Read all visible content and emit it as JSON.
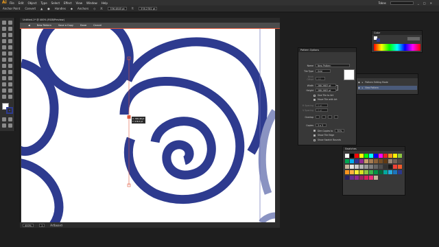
{
  "app": {
    "logo": "Ai"
  },
  "menu": [
    "File",
    "Edit",
    "Object",
    "Type",
    "Select",
    "Effect",
    "View",
    "Window",
    "Help"
  ],
  "workspace": "Tobas",
  "control_bar": {
    "mode": "Anchor Point",
    "convert_label": "Convert",
    "handles_label": "Handles",
    "anchors_label": "Anchors",
    "x_value": "336.4845 pt",
    "y_value": "378.2781 pt"
  },
  "document": {
    "tab_title": "Untitled-1* @ 400% (RGB/Preview)",
    "isolation": {
      "name": "New Pattern",
      "save_copy": "Save a Copy",
      "done": "Done",
      "cancel": "Cancel"
    },
    "zoom": "400%",
    "status": "Artboard",
    "page": "1"
  },
  "selection_tooltip": {
    "line1": "X: 336.48 pt",
    "line2": "Y: 378.3 pt"
  },
  "pattern_options": {
    "title": "Pattern Options",
    "name_label": "Name",
    "name_value": "New Pattern",
    "tile_type_label": "Tile Type",
    "tile_type_value": "Grid",
    "brick_offset_label": "Brick Offset",
    "brick_offset_value": "1/2",
    "width_label": "Width",
    "width_value": "288.2683 pt",
    "height_label": "Height",
    "height_value": "288.2683 pt",
    "size_tile_to_art": "Size Tile to Art",
    "move_tile_with_art": "Move Tile with Art",
    "h_spacing_label": "H Spacing",
    "h_spacing_value": "0 pt",
    "v_spacing_label": "V Spacing",
    "v_spacing_value": "0 pt",
    "overlap_label": "Overlap",
    "copies_label": "Copies",
    "copies_value": "3 x 3",
    "dim_copies_label": "Dim Copies to",
    "dim_copies_value": "70%",
    "show_tile_edge": "Show Tile Edge",
    "show_swatch_bounds": "Show Swatch Bounds"
  },
  "color_panel": {
    "title": "Color"
  },
  "layers_panel": {
    "rows": [
      "Pattern Editing Mode",
      "New Pattern"
    ]
  },
  "swatches_panel": {
    "title": "Swatches"
  },
  "colors": {
    "spiral": "#2e3b8f",
    "spiral_dim": "#8a93c2",
    "tile_guide": "#6f74b8",
    "accent": "#e0583a",
    "swatches": [
      "#ffffff",
      "#000000",
      "#ff0000",
      "#ffff00",
      "#00ff00",
      "#00ffff",
      "#0000ff",
      "#ff00ff",
      "#ed1c24",
      "#f7941d",
      "#fff200",
      "#8dc63f",
      "#00a651",
      "#00aeef",
      "#2e3192",
      "#92278f",
      "#c69c6d",
      "#a67c52",
      "#8c6239",
      "#754c24",
      "#603913",
      "#998675",
      "#736357",
      "#534741",
      "#c7b299",
      "#e6e6e6",
      "#cccccc",
      "#b3b3b3",
      "#999999",
      "#808080",
      "#666666",
      "#4d4d4d",
      "#333333",
      "#1a1a1a",
      "#ef4136",
      "#f15a29",
      "#f7941e",
      "#fbb040",
      "#f9ed32",
      "#d7df23",
      "#8dc63f",
      "#39b54a",
      "#009444",
      "#006838",
      "#00a79d",
      "#27aae1",
      "#1c75bc",
      "#2b388f",
      "#262262",
      "#662d91",
      "#92278f",
      "#9e1f63",
      "#da1c5c",
      "#ee2a7b",
      "#c2b59b"
    ]
  }
}
